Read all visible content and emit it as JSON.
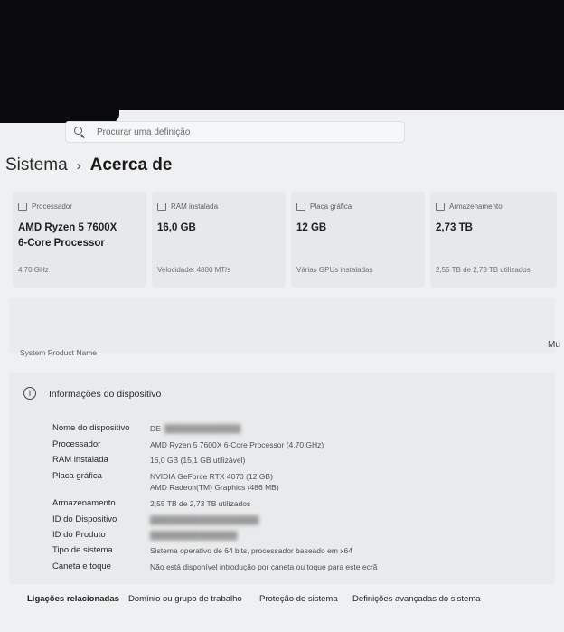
{
  "search": {
    "placeholder": "Procurar uma definição"
  },
  "breadcrumb": {
    "parent": "Sistema",
    "separator": "›",
    "current": "Acerca de"
  },
  "specs": [
    {
      "icon": "processor-icon",
      "label": "Processador",
      "value": "AMD Ryzen 5 7600X\n6-Core Processor",
      "detail": "4.70 GHz"
    },
    {
      "icon": "ram-icon",
      "label": "RAM instalada",
      "value": "16,0 GB",
      "detail": "Velocidade: 4800 MT/s"
    },
    {
      "icon": "graphics-card-icon",
      "label": "Placa gráfica",
      "value": "12 GB",
      "detail": "Várias GPUs instaladas"
    },
    {
      "icon": "storage-icon",
      "label": "Armazenamento",
      "value": "2,73 TB",
      "detail": "2,55 TB de 2,73 TB utilizados"
    }
  ],
  "system_product_name_label": "System Product Name",
  "side_text": "Mu",
  "device_info": {
    "title": "Informações do dispositivo",
    "rows": [
      {
        "label": "Nome do dispositivo",
        "value": "DE"
      },
      {
        "label": "Processador",
        "value": "AMD Ryzen 5 7600X 6-Core Processor (4.70 GHz)"
      },
      {
        "label": "RAM instalada",
        "value": "16,0 GB (15,1 GB utilizável)"
      },
      {
        "label": "Placa gráfica",
        "value": "NVIDIA GeForce RTX 4070 (12 GB)",
        "value2": "AMD Radeon(TM) Graphics (486 MB)"
      },
      {
        "label": "Armazenamento",
        "value": "2,55 TB de 2,73 TB utilizados"
      },
      {
        "label": "ID do Dispositivo",
        "value": ""
      },
      {
        "label": "ID do Produto",
        "value": ""
      },
      {
        "label": "Tipo de sistema",
        "value": "Sistema operativo de 64 bits, processador baseado em x64"
      },
      {
        "label": "Caneta e toque",
        "value": "Não está disponível introdução por caneta ou toque para este ecrã"
      }
    ]
  },
  "related": {
    "title": "Ligações relacionadas",
    "links": [
      "Domínio ou grupo de trabalho",
      "Proteção do sistema",
      "Definições avançadas do sistema"
    ]
  }
}
